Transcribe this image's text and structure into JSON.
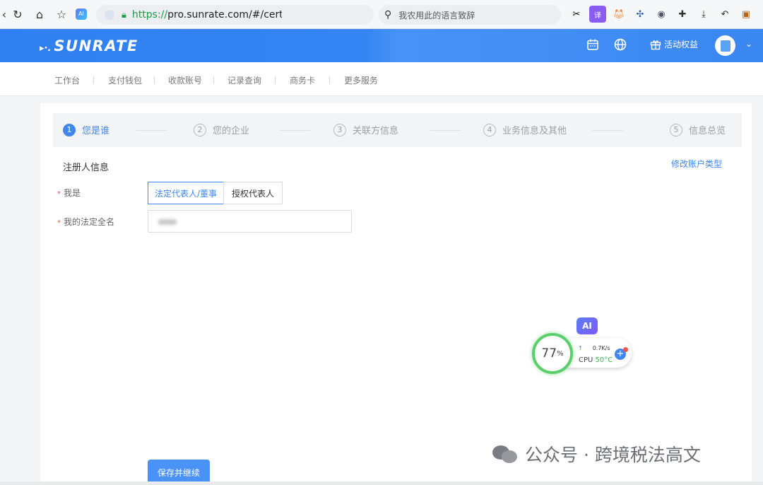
{
  "browser": {
    "url_protocol": "https://",
    "url_rest": "pro.sunrate.com/#/cert/cc",
    "search_placeholder": "我农用此的语言致辞",
    "ext_ai": "AI",
    "ext_translate": "译"
  },
  "header": {
    "logo_text": "SUNRATE",
    "logo_dots": "▸·.",
    "benefits_label": "活动权益"
  },
  "subnav": [
    "工作台",
    "支付钱包",
    "收款账号",
    "记录查询",
    "商务卡",
    "更多服务"
  ],
  "steps": [
    {
      "num": "1",
      "label": "您是谁"
    },
    {
      "num": "2",
      "label": "您的企业"
    },
    {
      "num": "3",
      "label": "关联方信息"
    },
    {
      "num": "4",
      "label": "业务信息及其他"
    },
    {
      "num": "5",
      "label": "信息总览"
    }
  ],
  "form": {
    "section_title": "注册人信息",
    "edit_account_type": "修改账户类型",
    "role_label": "我是",
    "role_options": [
      "法定代表人/董事",
      "授权代表人"
    ],
    "role_selected": "法定代表人/董事",
    "name_label": "我的法定全名",
    "required_mark": "*",
    "save_button": "保存并继续"
  },
  "cpu_widget": {
    "ai_label": "AI",
    "percent": "77",
    "percent_sign": "%",
    "net_arrow": "↑",
    "net_speed": "0.7K/s",
    "cpu_label": "CPU",
    "temp": "50°C"
  },
  "watermark": "公众号 · 跨境税法高文",
  "colors": {
    "brand_blue": "#3485f3",
    "active_step": "#3e86f0",
    "ring_green": "#5bd06a"
  }
}
